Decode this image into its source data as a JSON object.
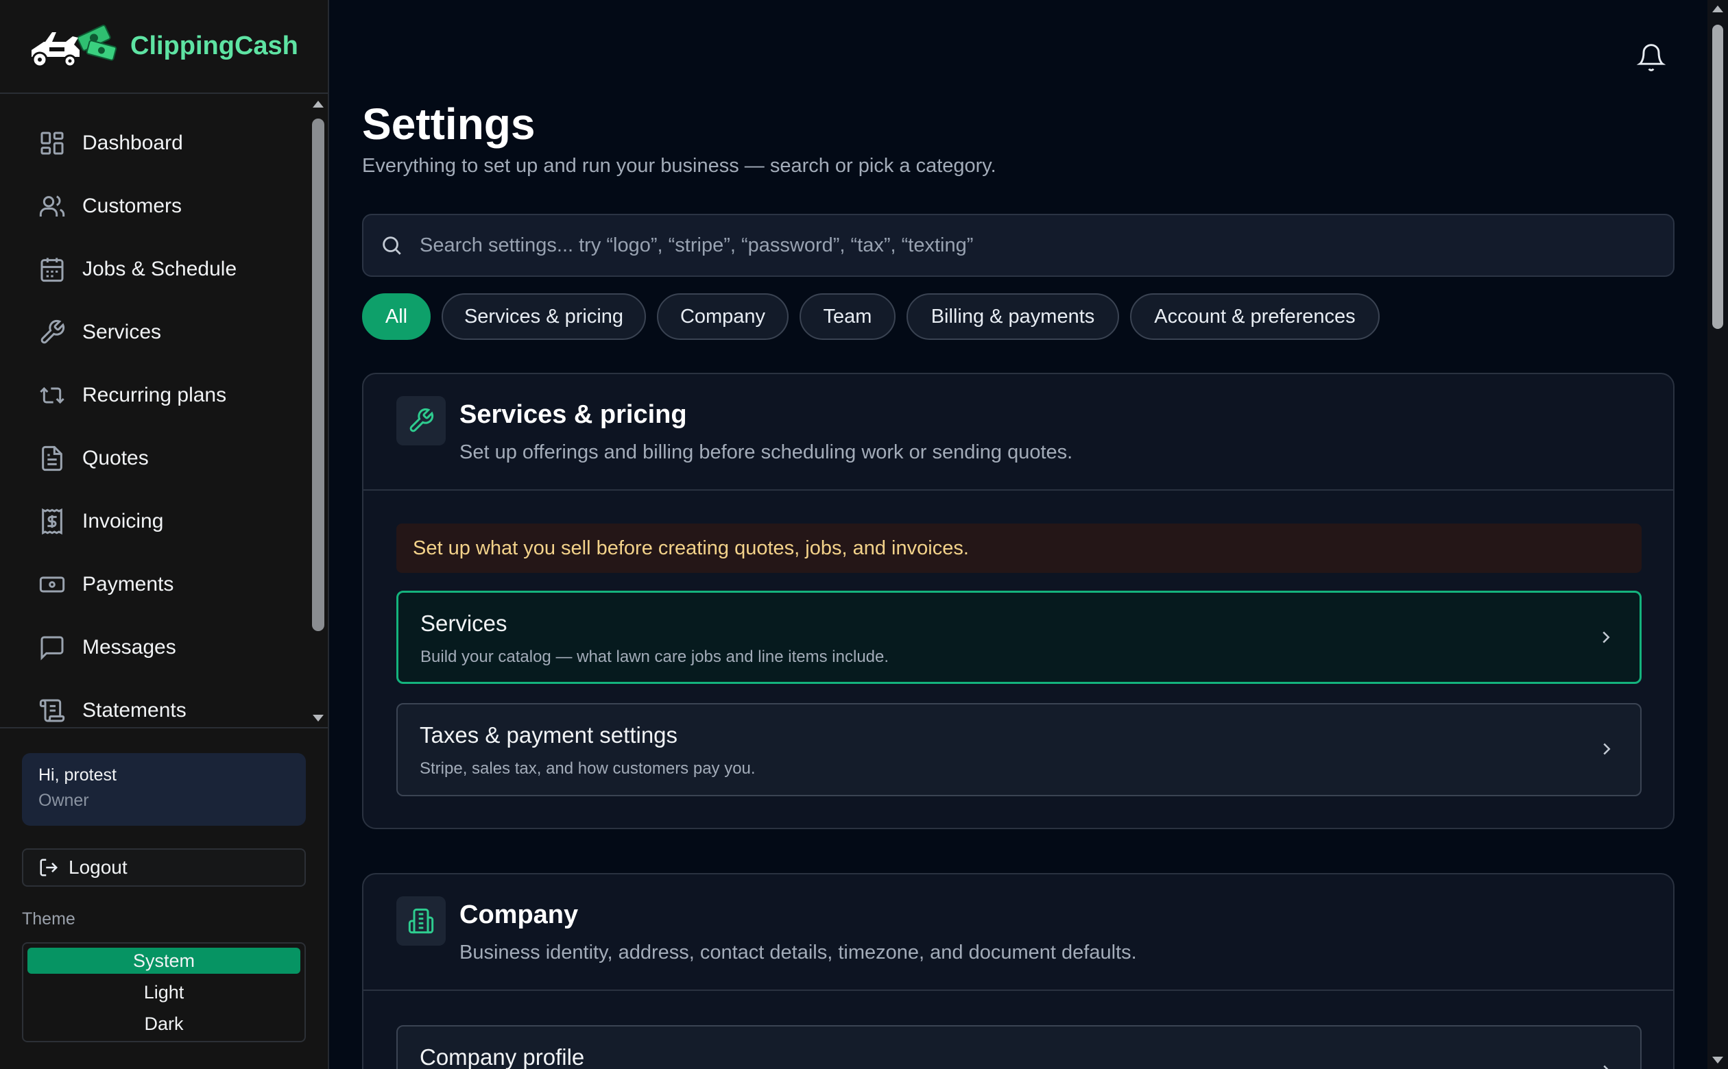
{
  "app": {
    "name": "ClippingCash",
    "accent_color": "#5ee3a3",
    "logo_icon": "lawn-mower-cash-logo"
  },
  "sidebar": {
    "items": [
      {
        "label": "Dashboard",
        "icon": "dashboard-grid-icon"
      },
      {
        "label": "Customers",
        "icon": "users-icon"
      },
      {
        "label": "Jobs & Schedule",
        "icon": "calendar-icon"
      },
      {
        "label": "Services",
        "icon": "wrench-icon"
      },
      {
        "label": "Recurring plans",
        "icon": "repeat-icon"
      },
      {
        "label": "Quotes",
        "icon": "document-icon"
      },
      {
        "label": "Invoicing",
        "icon": "invoice-dollar-icon"
      },
      {
        "label": "Payments",
        "icon": "banknote-icon"
      },
      {
        "label": "Messages",
        "icon": "chat-icon"
      },
      {
        "label": "Statements",
        "icon": "scroll-icon"
      }
    ],
    "user": {
      "greeting": "Hi, protest",
      "role": "Owner"
    },
    "logout_label": "Logout",
    "theme": {
      "label": "Theme",
      "options": [
        "System",
        "Light",
        "Dark"
      ],
      "selected": "System"
    }
  },
  "main": {
    "title": "Settings",
    "subtitle": "Everything to set up and run your business — search or pick a category.",
    "search": {
      "placeholder": "Search settings... try “logo”, “stripe”, “password”, “tax”, “texting”",
      "value": ""
    },
    "filters": [
      "All",
      "Services & pricing",
      "Company",
      "Team",
      "Billing & payments",
      "Account & preferences"
    ],
    "active_filter": "All",
    "sections": [
      {
        "title": "Services & pricing",
        "description": "Set up offerings and billing before scheduling work or sending quotes.",
        "icon": "wrench-icon",
        "notice": "Set up what you sell before creating quotes, jobs, and invoices.",
        "items": [
          {
            "title": "Services",
            "description": "Build your catalog — what lawn care jobs and line items include.",
            "highlighted": true
          },
          {
            "title": "Taxes & payment settings",
            "description": "Stripe, sales tax, and how customers pay you.",
            "highlighted": false
          }
        ]
      },
      {
        "title": "Company",
        "description": "Business identity, address, contact details, timezone, and document defaults.",
        "icon": "building-icon",
        "items": [
          {
            "title": "Company profile"
          }
        ]
      }
    ]
  }
}
